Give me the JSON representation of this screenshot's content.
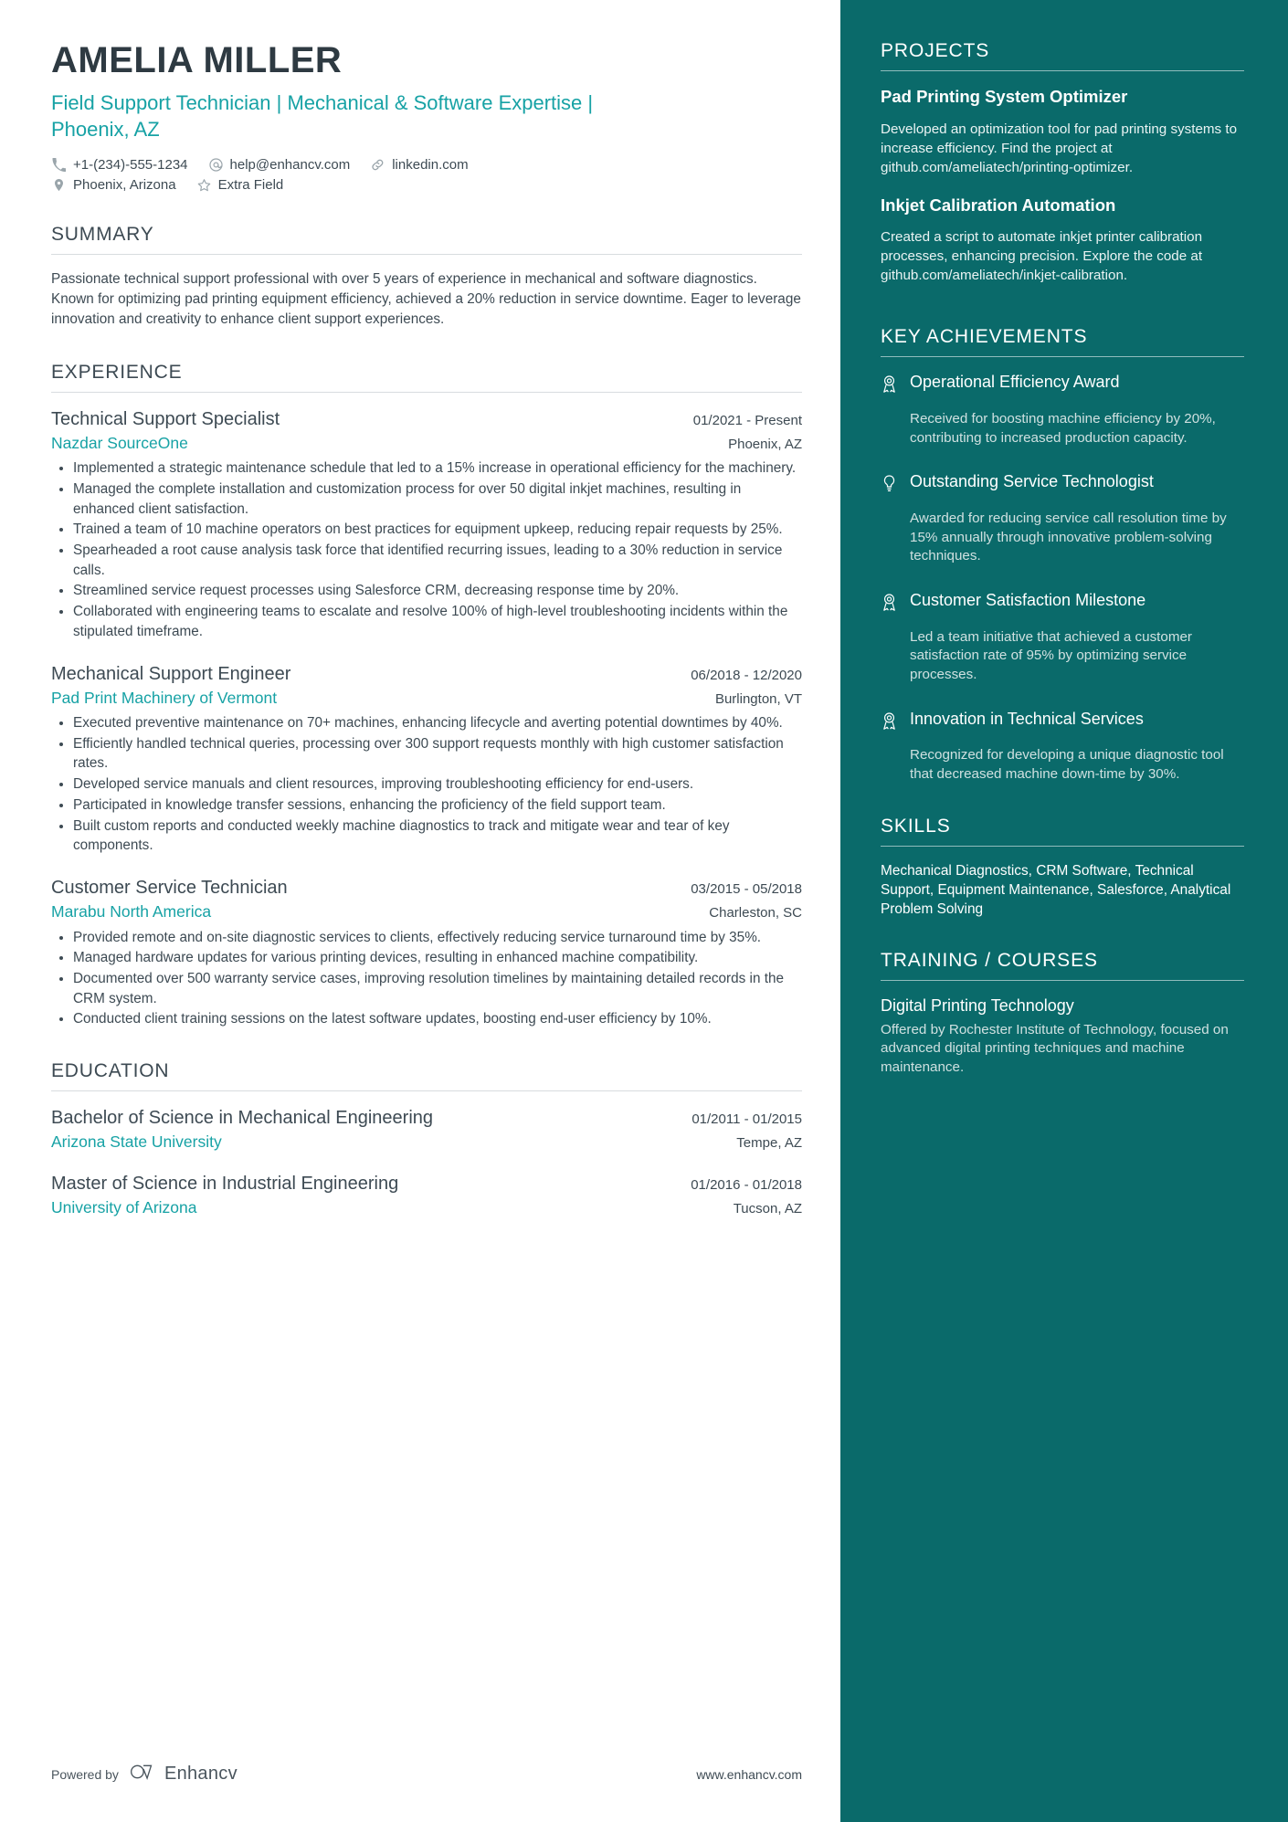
{
  "header": {
    "name": "AMELIA MILLER",
    "headline": "Field Support Technician | Mechanical & Software Expertise | Phoenix, AZ",
    "contacts": [
      {
        "icon": "phone-icon",
        "text": "+1-(234)-555-1234"
      },
      {
        "icon": "email-icon",
        "text": "help@enhancv.com"
      },
      {
        "icon": "link-icon",
        "text": "linkedin.com"
      },
      {
        "icon": "location-icon",
        "text": "Phoenix, Arizona"
      },
      {
        "icon": "star-icon",
        "text": "Extra Field"
      }
    ]
  },
  "summary": {
    "title": "SUMMARY",
    "text": "Passionate technical support professional with over 5 years of experience in mechanical and software diagnostics. Known for optimizing pad printing equipment efficiency, achieved a 20% reduction in service downtime. Eager to leverage innovation and creativity to enhance client support experiences."
  },
  "experience": {
    "title": "EXPERIENCE",
    "entries": [
      {
        "role": "Technical Support Specialist",
        "date": "01/2021 - Present",
        "company": "Nazdar SourceOne",
        "location": "Phoenix, AZ",
        "bullets": [
          "Implemented a strategic maintenance schedule that led to a 15% increase in operational efficiency for the machinery.",
          "Managed the complete installation and customization process for over 50 digital inkjet machines, resulting in enhanced client satisfaction.",
          "Trained a team of 10 machine operators on best practices for equipment upkeep, reducing repair requests by 25%.",
          "Spearheaded a root cause analysis task force that identified recurring issues, leading to a 30% reduction in service calls.",
          "Streamlined service request processes using Salesforce CRM, decreasing response time by 20%.",
          "Collaborated with engineering teams to escalate and resolve 100% of high-level troubleshooting incidents within the stipulated timeframe."
        ]
      },
      {
        "role": "Mechanical Support Engineer",
        "date": "06/2018 - 12/2020",
        "company": "Pad Print Machinery of Vermont",
        "location": "Burlington, VT",
        "bullets": [
          "Executed preventive maintenance on 70+ machines, enhancing lifecycle and averting potential downtimes by 40%.",
          "Efficiently handled technical queries, processing over 300 support requests monthly with high customer satisfaction rates.",
          "Developed service manuals and client resources, improving troubleshooting efficiency for end-users.",
          "Participated in knowledge transfer sessions, enhancing the proficiency of the field support team.",
          "Built custom reports and conducted weekly machine diagnostics to track and mitigate wear and tear of key components."
        ]
      },
      {
        "role": "Customer Service Technician",
        "date": "03/2015 - 05/2018",
        "company": "Marabu North America",
        "location": "Charleston, SC",
        "bullets": [
          "Provided remote and on-site diagnostic services to clients, effectively reducing service turnaround time by 35%.",
          "Managed hardware updates for various printing devices, resulting in enhanced machine compatibility.",
          "Documented over 500 warranty service cases, improving resolution timelines by maintaining detailed records in the CRM system.",
          "Conducted client training sessions on the latest software updates, boosting end-user efficiency by 10%."
        ]
      }
    ]
  },
  "education": {
    "title": "EDUCATION",
    "entries": [
      {
        "degree": "Bachelor of Science in Mechanical Engineering",
        "date": "01/2011 - 01/2015",
        "school": "Arizona State University",
        "location": "Tempe, AZ"
      },
      {
        "degree": "Master of Science in Industrial Engineering",
        "date": "01/2016 - 01/2018",
        "school": "University of Arizona",
        "location": "Tucson, AZ"
      }
    ]
  },
  "footer": {
    "powered_by": "Powered by",
    "brand": "Enhancv",
    "url": "www.enhancv.com"
  },
  "sidebar": {
    "projects": {
      "title": "PROJECTS",
      "items": [
        {
          "name": "Pad Printing System Optimizer",
          "description": "Developed an optimization tool for pad printing systems to increase efficiency. Find the project at github.com/ameliatech/printing-optimizer."
        },
        {
          "name": "Inkjet Calibration Automation",
          "description": "Created a script to automate inkjet printer calibration processes, enhancing precision. Explore the code at github.com/ameliatech/inkjet-calibration."
        }
      ]
    },
    "achievements": {
      "title": "KEY ACHIEVEMENTS",
      "items": [
        {
          "icon": "award-ribbon-icon",
          "title": "Operational Efficiency Award",
          "description": "Received for boosting machine efficiency by 20%, contributing to increased production capacity."
        },
        {
          "icon": "lightbulb-icon",
          "title": "Outstanding Service Technologist",
          "description": "Awarded for reducing service call resolution time by 15% annually through innovative problem-solving techniques."
        },
        {
          "icon": "award-ribbon-icon",
          "title": "Customer Satisfaction Milestone",
          "description": "Led a team initiative that achieved a customer satisfaction rate of 95% by optimizing service processes."
        },
        {
          "icon": "award-ribbon-icon",
          "title": "Innovation in Technical Services",
          "description": "Recognized for developing a unique diagnostic tool that decreased machine down-time by 30%."
        }
      ]
    },
    "skills": {
      "title": "SKILLS",
      "text": "Mechanical Diagnostics, CRM Software, Technical Support, Equipment Maintenance, Salesforce, Analytical Problem Solving"
    },
    "training": {
      "title": "TRAINING / COURSES",
      "items": [
        {
          "name": "Digital Printing Technology",
          "description": "Offered by Rochester Institute of Technology, focused on advanced digital printing techniques and machine maintenance."
        }
      ]
    }
  },
  "colors": {
    "accent_teal": "#17a2a5",
    "sidebar_bg": "#0a6a6a",
    "text_dark": "#3d4a53"
  }
}
